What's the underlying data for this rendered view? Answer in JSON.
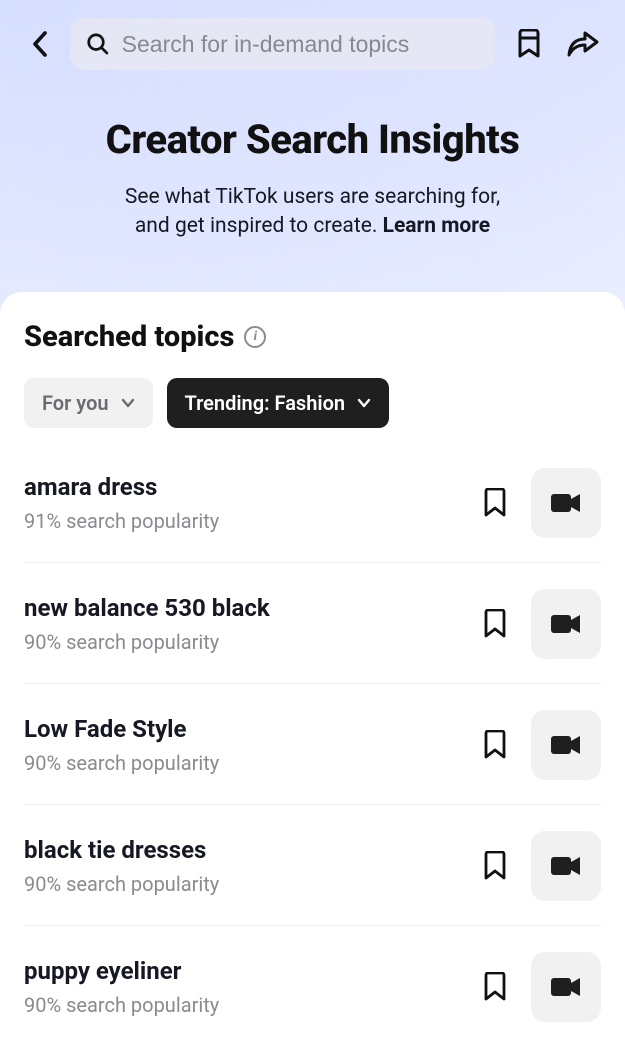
{
  "header": {
    "search_placeholder": "Search for in-demand topics"
  },
  "hero": {
    "title": "Creator Search Insights",
    "subtitle_line1": "See what TikTok users are searching for,",
    "subtitle_line2": "and get inspired to create. ",
    "learn_more": "Learn more"
  },
  "section": {
    "title": "Searched topics"
  },
  "filters": {
    "for_you": "For you",
    "trending": "Trending: Fashion"
  },
  "topics": [
    {
      "title": "amara dress",
      "subtitle": "91% search popularity"
    },
    {
      "title": "new balance 530 black",
      "subtitle": "90% search popularity"
    },
    {
      "title": "Low Fade Style",
      "subtitle": "90% search popularity"
    },
    {
      "title": "black tie dresses",
      "subtitle": "90% search popularity"
    },
    {
      "title": "puppy eyeliner",
      "subtitle": "90% search popularity"
    }
  ]
}
